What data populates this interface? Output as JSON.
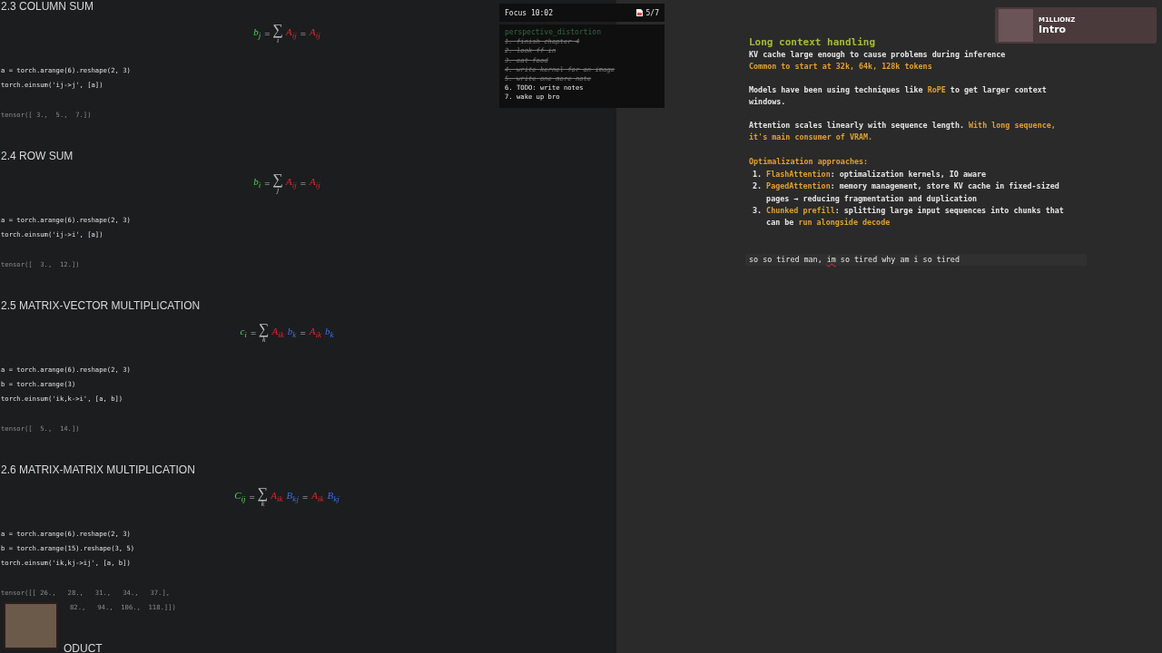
{
  "notebook": {
    "sections": [
      {
        "heading": "2.3 COLUMN SUM",
        "formula": [
          {
            "kind": "out",
            "text": "b$_{j}$"
          },
          {
            "kind": "op",
            "text": "="
          },
          {
            "kind": "sum",
            "text": "∑",
            "index": "i"
          },
          {
            "kind": "a",
            "text": "A$_{ij}$"
          },
          {
            "kind": "op",
            "text": "="
          },
          {
            "kind": "a",
            "text": "A$_{ij}$"
          }
        ],
        "code": [
          "a = torch.arange(6).reshape(2, 3)",
          "torch.einsum('ij->j', [a])"
        ],
        "output": [
          "tensor([ 3.,  5.,  7.])"
        ]
      },
      {
        "heading": "2.4 ROW SUM",
        "formula": [
          {
            "kind": "out",
            "text": "b$_{i}$"
          },
          {
            "kind": "op",
            "text": "="
          },
          {
            "kind": "sum",
            "text": "∑",
            "index": "j"
          },
          {
            "kind": "a",
            "text": "A$_{ij}$"
          },
          {
            "kind": "op",
            "text": "="
          },
          {
            "kind": "a",
            "text": "A$_{ij}$"
          }
        ],
        "code": [
          "a = torch.arange(6).reshape(2, 3)",
          "torch.einsum('ij->i', [a])"
        ],
        "output": [
          "tensor([  3.,  12.])"
        ]
      },
      {
        "heading": "2.5 MATRIX-VECTOR MULTIPLICATION",
        "formula": [
          {
            "kind": "out",
            "text": "c$_{i}$"
          },
          {
            "kind": "op",
            "text": "="
          },
          {
            "kind": "sum",
            "text": "∑",
            "index": "k"
          },
          {
            "kind": "a",
            "text": "A$_{ik}$"
          },
          {
            "kind": "b",
            "text": "b$_{k}$"
          },
          {
            "kind": "op",
            "text": "="
          },
          {
            "kind": "a",
            "text": "A$_{ik}$"
          },
          {
            "kind": "b",
            "text": "b$_{k}$"
          }
        ],
        "code": [
          "a = torch.arange(6).reshape(2, 3)",
          "b = torch.arange(3)",
          "torch.einsum('ik,k->i', [a, b])"
        ],
        "output": [
          "tensor([  5.,  14.])"
        ]
      },
      {
        "heading": "2.6 MATRIX-MATRIX MULTIPLICATION",
        "formula": [
          {
            "kind": "out",
            "text": "C$_{ij}$"
          },
          {
            "kind": "op",
            "text": "="
          },
          {
            "kind": "sum",
            "text": "∑",
            "index": "k"
          },
          {
            "kind": "a",
            "text": "A$_{ik}$"
          },
          {
            "kind": "b",
            "text": "B$_{kj}$"
          },
          {
            "kind": "op",
            "text": "="
          },
          {
            "kind": "a",
            "text": "A$_{ik}$"
          },
          {
            "kind": "b",
            "text": "B$_{kj}$"
          }
        ],
        "code": [
          "a = torch.arange(6).reshape(2, 3)",
          "b = torch.arange(15).reshape(3, 5)",
          "torch.einsum('ik,kj->ij', [a, b])"
        ],
        "output": [
          "tensor([[ 26.,   28.,   31.,   34.,   37.],",
          "82.,   94.,  106.,  118.]])"
        ]
      }
    ],
    "cut_heading": "ODUCT"
  },
  "focus": {
    "title": "Focus 10:02",
    "count": "5/7",
    "list_title": "perspective_distortion",
    "items": [
      {
        "text": "1. finish chapter 4",
        "done": true
      },
      {
        "text": "2. look ff in",
        "done": true
      },
      {
        "text": "3. eat food",
        "done": true
      },
      {
        "text": "4. write kernel for an image",
        "done": true
      },
      {
        "text": "5. write one more note",
        "done": true
      },
      {
        "text": "6. TODO: write notes",
        "done": false
      },
      {
        "text": "7. wake up bro",
        "done": false
      }
    ]
  },
  "now_playing": {
    "artist": "M1LLIONZ",
    "title": "Intro"
  },
  "notes": {
    "title": "Long context handling",
    "blocks": [
      {
        "kind": "para",
        "lines": [
          [
            {
              "text": "KV cache large enough to cause problems during inference",
              "highlight": false
            }
          ],
          [
            {
              "text": "Common to start at 32k, 64k, 128k tokens",
              "highlight": true
            }
          ]
        ]
      },
      {
        "kind": "para",
        "lines": [
          [
            {
              "text": "Models have been using techniques like ",
              "highlight": false
            },
            {
              "text": "RoPE",
              "highlight": true
            },
            {
              "text": " to get larger context windows.",
              "highlight": false
            }
          ]
        ]
      },
      {
        "kind": "para",
        "lines": [
          [
            {
              "text": "Attention scales linearly with sequence length. ",
              "highlight": false
            },
            {
              "text": "With long sequence, it's main consumer of VRAM.",
              "highlight": true
            }
          ]
        ]
      },
      {
        "kind": "list",
        "heading": "Optimalization approaches:",
        "items": [
          {
            "marker": "1.",
            "segments": [
              {
                "text": "FlashAttention",
                "highlight": true
              },
              {
                "text": ": optimalization kernels, IO aware",
                "highlight": false
              }
            ]
          },
          {
            "marker": "2.",
            "segments": [
              {
                "text": "PagedAttention",
                "highlight": true
              },
              {
                "text": ": memory management, store KV cache in fixed-sized pages → reducing fragmentation and duplication",
                "highlight": false
              }
            ]
          },
          {
            "marker": "3.",
            "segments": [
              {
                "text": "Chunked prefill",
                "highlight": true
              },
              {
                "text": ": splitting large input sequences into chunks that can be ",
                "highlight": false
              },
              {
                "text": "run alongside decode",
                "highlight": true
              }
            ]
          }
        ]
      }
    ],
    "cursor_line": [
      {
        "text": "so so tired man, ",
        "misspelled": false
      },
      {
        "text": "im",
        "misspelled": true
      },
      {
        "text": " so tired why am i so tired",
        "misspelled": false
      }
    ]
  }
}
